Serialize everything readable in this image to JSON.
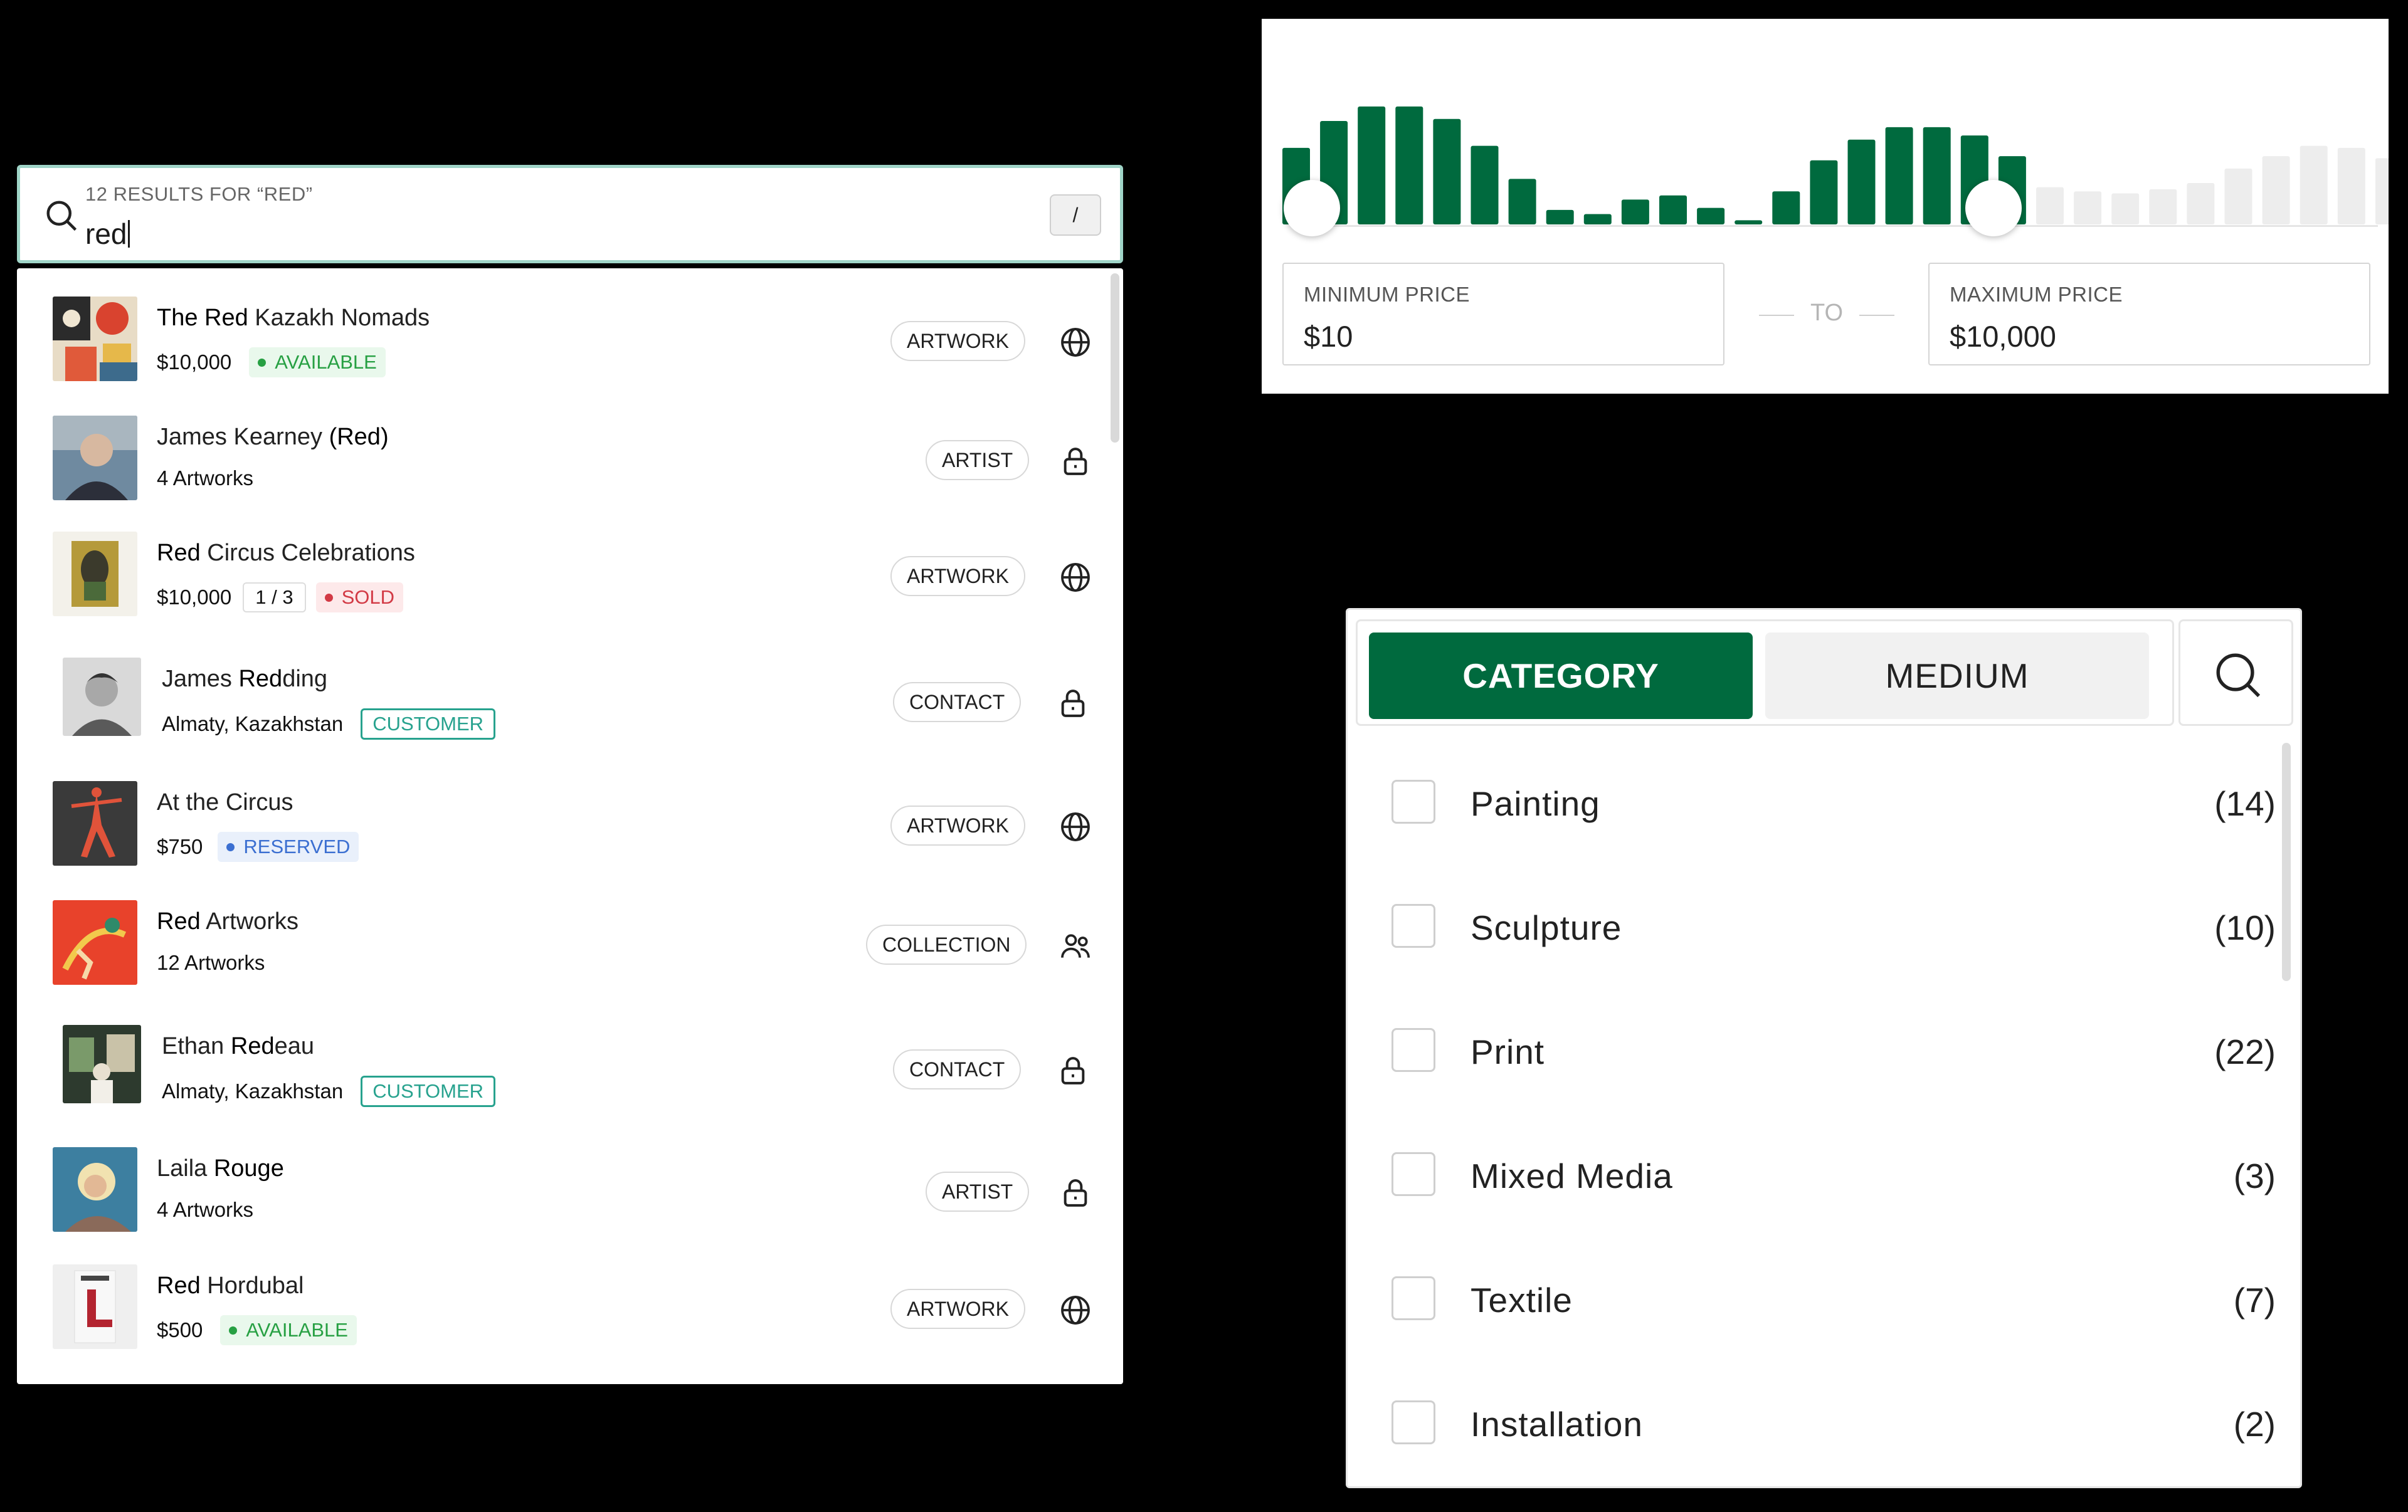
{
  "search": {
    "results_count": "12 RESULTS FOR “RED”",
    "query": "red",
    "shortcut": "/"
  },
  "results": [
    {
      "kind": "artwork",
      "title_hl": "The Red",
      "title_rest": " Kazakh Nomads",
      "title_pre": "",
      "price": "$10,000",
      "status": "AVAILABLE",
      "type": "ARTWORK",
      "icon": "globe-icon"
    },
    {
      "kind": "artist",
      "title_pre": "James Kearney ",
      "title_hl": "(Red)",
      "title_rest": "",
      "subtitle": "4 Artworks",
      "type": "ARTIST",
      "icon": "lock-icon"
    },
    {
      "kind": "artwork",
      "title_hl": "Red",
      "title_rest": " Circus Celebrations",
      "title_pre": "",
      "price": "$10,000",
      "edition": "1 / 3",
      "status": "SOLD",
      "type": "ARTWORK",
      "icon": "globe-icon"
    },
    {
      "kind": "contact",
      "title_pre": "James ",
      "title_hl": "Red",
      "title_rest": "ding",
      "location": "Almaty, Kazakhstan",
      "badge": "CUSTOMER",
      "type": "CONTACT",
      "icon": "lock-icon"
    },
    {
      "kind": "artwork",
      "title_pre": "At the Circus",
      "title_hl": "",
      "title_rest": "",
      "price": "$750",
      "status": "RESERVED",
      "type": "ARTWORK",
      "icon": "globe-icon"
    },
    {
      "kind": "collection",
      "title_hl": "Red",
      "title_rest": " Artworks",
      "title_pre": "",
      "subtitle": "12 Artworks",
      "type": "COLLECTION",
      "icon": "users-icon"
    },
    {
      "kind": "contact",
      "title_pre": "Ethan ",
      "title_hl": "Red",
      "title_rest": "eau",
      "location": "Almaty, Kazakhstan",
      "badge": "CUSTOMER",
      "type": "CONTACT",
      "icon": "lock-icon"
    },
    {
      "kind": "artist",
      "title_pre": "Laila ",
      "title_hl": "Rouge",
      "title_rest": "",
      "subtitle": "4 Artworks",
      "type": "ARTIST",
      "icon": "lock-icon"
    },
    {
      "kind": "artwork",
      "title_hl": "Red",
      "title_rest": " Hordubal",
      "title_pre": "",
      "price": "$500",
      "status": "AVAILABLE",
      "type": "ARTWORK",
      "icon": "globe-icon"
    }
  ],
  "price_filter": {
    "min_label": "MINIMUM PRICE",
    "min_value": "$10",
    "to_label": "TO",
    "max_label": "MAXIMUM PRICE",
    "max_value": "$10,000",
    "histogram_levels": [
      0.37,
      0.5,
      0.57,
      0.57,
      0.51,
      0.38,
      0.22,
      0.07,
      0.05,
      0.12,
      0.14,
      0.08,
      0.02,
      0.16,
      0.31,
      0.41,
      0.47,
      0.47,
      0.43,
      0.33,
      0.18,
      0.16,
      0.15,
      0.17,
      0.2,
      0.27,
      0.33,
      0.38,
      0.37,
      0.32
    ],
    "selected_range_fraction": [
      0.0,
      0.64
    ],
    "active_color": "#006a3e",
    "inactive_color": "#ededed"
  },
  "category_filter": {
    "tabs": [
      {
        "label": "CATEGORY",
        "active": true
      },
      {
        "label": "MEDIUM",
        "active": false
      }
    ],
    "items": [
      {
        "label": "Painting",
        "count": "(14)",
        "checked": false
      },
      {
        "label": "Sculpture",
        "count": "(10)",
        "checked": false
      },
      {
        "label": "Print",
        "count": "(22)",
        "checked": false
      },
      {
        "label": "Mixed Media",
        "count": "(3)",
        "checked": false
      },
      {
        "label": "Textile",
        "count": "(7)",
        "checked": false
      },
      {
        "label": "Installation",
        "count": "(2)",
        "checked": false
      }
    ]
  },
  "colors": {
    "accent": "#006a3e",
    "focus_border": "#9fd4c7",
    "available": "#27a043",
    "sold": "#d23a45",
    "reserved": "#3b6fd1",
    "customer": "#27a28e"
  }
}
